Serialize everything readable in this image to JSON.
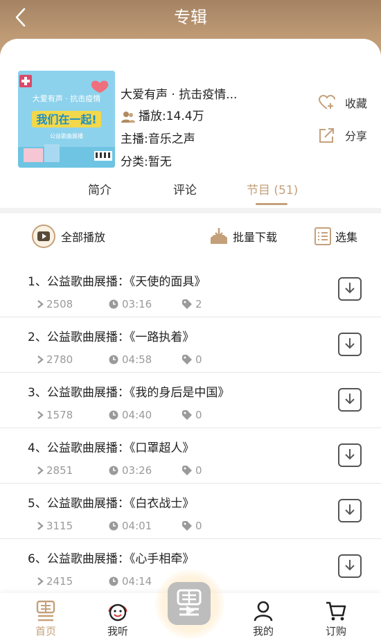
{
  "header": {
    "title": "专辑"
  },
  "album": {
    "title": "大爱有声 · 抗击疫情...",
    "plays": "播放:14.4万",
    "host": "主播:音乐之声",
    "category": "分类:暂无",
    "collect_label": "收藏",
    "share_label": "分享",
    "cover": {
      "line1": "大爱有声 · 抗击疫情",
      "line2": "我们在一起!",
      "line3": "公益歌曲展播"
    }
  },
  "tabs": [
    {
      "label": "简介"
    },
    {
      "label": "评论"
    },
    {
      "label": "节目 (51)"
    }
  ],
  "toolbar": {
    "play_all": "全部播放",
    "batch_download": "批量下载",
    "select": "选集"
  },
  "episodes": [
    {
      "title": "1、公益歌曲展播：《天使的面具》",
      "plays": "2508",
      "duration": "03:16",
      "tags": "2"
    },
    {
      "title": "2、公益歌曲展播：《一路执着》",
      "plays": "2780",
      "duration": "04:58",
      "tags": "0"
    },
    {
      "title": "3、公益歌曲展播：《我的身后是中国》",
      "plays": "1578",
      "duration": "04:40",
      "tags": "0"
    },
    {
      "title": "4、公益歌曲展播：《口罩超人》",
      "plays": "2851",
      "duration": "03:26",
      "tags": "0"
    },
    {
      "title": "5、公益歌曲展播：《白衣战士》",
      "plays": "3115",
      "duration": "04:01",
      "tags": "0"
    },
    {
      "title": "6、公益歌曲展播：《心手相牵》",
      "plays": "2415",
      "duration": "04:14",
      "tags": ""
    }
  ],
  "nav": [
    {
      "label": "首页"
    },
    {
      "label": "我听"
    },
    {
      "label": "我的"
    },
    {
      "label": "订购"
    }
  ],
  "colors": {
    "accent": "#c4a07a",
    "header_top": "#a58363",
    "header_bottom": "#cfae87",
    "muted": "#9a9a9a"
  }
}
